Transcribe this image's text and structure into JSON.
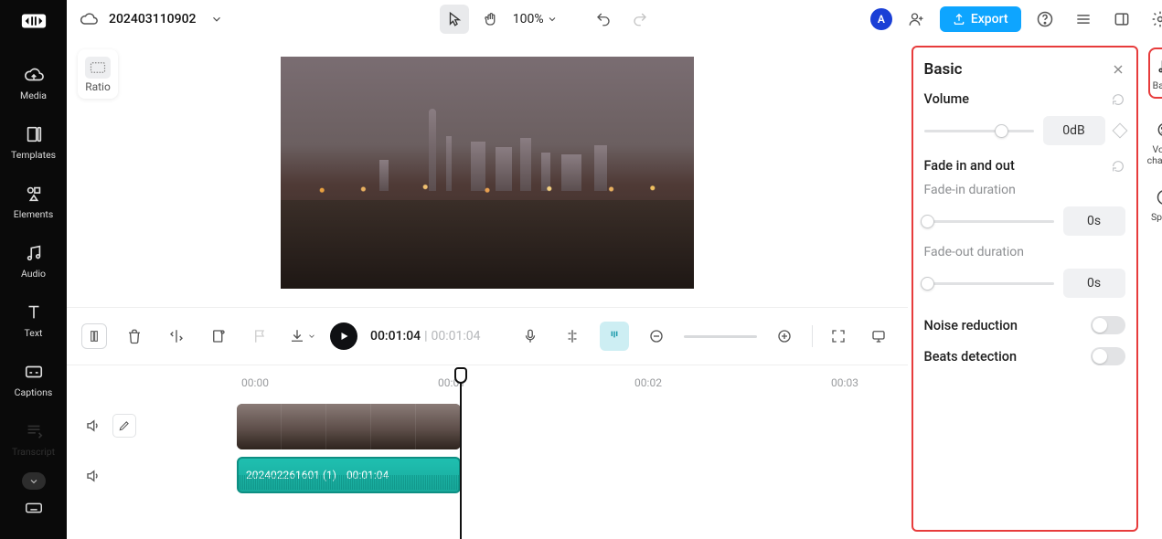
{
  "project": {
    "name": "202403110902"
  },
  "topbar": {
    "zoom": "100%",
    "avatar_letter": "A",
    "export_label": "Export"
  },
  "left_nav": {
    "items": [
      {
        "label": "Media"
      },
      {
        "label": "Templates"
      },
      {
        "label": "Elements"
      },
      {
        "label": "Audio"
      },
      {
        "label": "Text"
      },
      {
        "label": "Captions"
      },
      {
        "label": "Transcript"
      }
    ]
  },
  "ratio": {
    "label": "Ratio"
  },
  "transport": {
    "current_time": "00:01:04",
    "total_time": "00:01:04"
  },
  "ruler": {
    "ticks": [
      "00:00",
      "00:01",
      "00:02",
      "00:03"
    ]
  },
  "audio_clip": {
    "name": "202402261601 (1)",
    "duration": "00:01:04"
  },
  "props": {
    "title": "Basic",
    "volume": {
      "label": "Volume",
      "value": "0dB",
      "slider_pct": 70
    },
    "fade": {
      "label": "Fade in and out",
      "in_label": "Fade-in duration",
      "in_value": "0s",
      "out_label": "Fade-out duration",
      "out_value": "0s"
    },
    "noise": {
      "label": "Noise reduction"
    },
    "beats": {
      "label": "Beats detection"
    }
  },
  "rail": {
    "items": [
      {
        "label": "Basic"
      },
      {
        "label": "Voice changer"
      },
      {
        "label": "Speed"
      }
    ]
  }
}
